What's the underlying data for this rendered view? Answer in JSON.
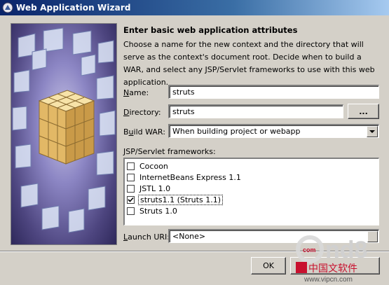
{
  "window": {
    "title": "Web Application Wizard",
    "icon": "wizard-app-icon"
  },
  "page": {
    "heading": "Enter basic web application attributes",
    "description": "Choose a name for the new context and the directory that will serve as the context's document root. Decide when to build a WAR, and select any JSP/Servlet frameworks to use with this web application."
  },
  "form": {
    "name": {
      "label_key": "N",
      "label_rest": "ame:",
      "value": "struts"
    },
    "directory": {
      "label_key": "D",
      "label_rest": "irectory:",
      "value": "struts",
      "browse_label": "..."
    },
    "build_war": {
      "label_pre": "B",
      "label_key": "u",
      "label_rest": "ild WAR:",
      "value": "When building project or webapp"
    },
    "frameworks": {
      "label": "JSP/Servlet frameworks:",
      "items": [
        {
          "label": "Cocoon",
          "checked": false
        },
        {
          "label": "InternetBeans Express 1.1",
          "checked": false
        },
        {
          "label": "JSTL 1.0",
          "checked": false
        },
        {
          "label": "struts1.1 (Struts 1.1)",
          "checked": true,
          "focused": true
        },
        {
          "label": "Struts 1.0",
          "checked": false
        }
      ]
    },
    "launch_uri": {
      "label_key": "L",
      "label_rest": "aunch URI:",
      "value": "<None>"
    }
  },
  "buttons": {
    "ok": "OK"
  },
  "watermark": {
    "brand": "cnd8",
    "com": "com",
    "cn_text": "中国文软件",
    "url": "www.vipcn.com"
  }
}
